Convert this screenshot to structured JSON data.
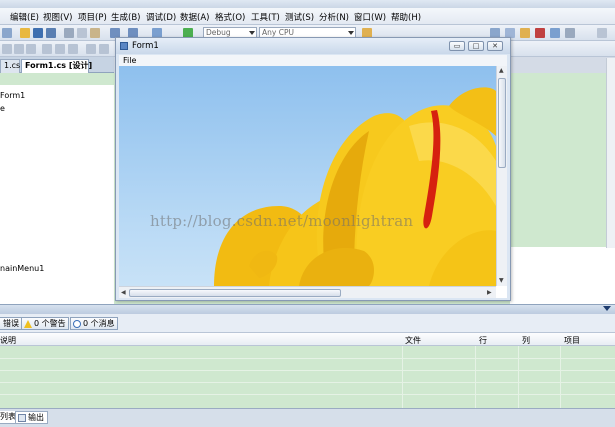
{
  "menu": [
    "编辑(E)",
    "视图(V)",
    "项目(P)",
    "生成(B)",
    "调试(D)",
    "数据(A)",
    "格式(O)",
    "工具(T)",
    "测试(S)",
    "分析(N)",
    "窗口(W)",
    "帮助(H)"
  ],
  "toolbar": {
    "config": "Debug",
    "platform": "Any CPU"
  },
  "tabs": {
    "inactive": "1.cs",
    "active": "Form1.cs [设计]"
  },
  "left_panel": {
    "label1": "Form1",
    "label2": "e",
    "label3": "nainMenu1"
  },
  "form": {
    "title": "Form1",
    "menu_item": "File",
    "min_glyph": "▭",
    "max_glyph": "□",
    "close_glyph": "✕"
  },
  "watermark": "http://blog.csdn.net/moonlightran",
  "error_list": {
    "errors_label": "错误",
    "warnings_label": "0 个警告",
    "messages_label": "0 个消息",
    "columns": {
      "desc": "说明",
      "file": "文件",
      "line": "行",
      "col": "列",
      "project": "项目"
    }
  },
  "bottom_tabs": {
    "list": "列表",
    "output": "输出"
  },
  "colors": {
    "flower": "#f7c51a",
    "flower_dark": "#e0a30c",
    "stripe": "#d61a10",
    "sky": "#8ec0ee",
    "designer_bg": "#cfe8cf"
  },
  "icons": [
    "form-icon",
    "warning-icon",
    "info-icon",
    "output-icon"
  ]
}
